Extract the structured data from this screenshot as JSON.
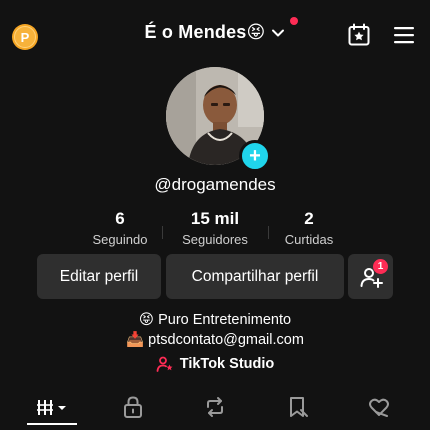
{
  "header": {
    "coin_label": "P",
    "title": "É o Mendes😝",
    "has_notification": true
  },
  "profile": {
    "username": "@drogamendes",
    "stats": [
      {
        "value": "6",
        "label": "Seguindo"
      },
      {
        "value": "15 mil",
        "label": "Seguidores"
      },
      {
        "value": "2",
        "label": "Curtidas"
      }
    ],
    "buttons": {
      "edit": "Editar perfil",
      "share": "Compartilhar perfil",
      "add_friends_badge": "1"
    },
    "bio": [
      {
        "emoji": "😝",
        "text": "Puro Entretenimento"
      },
      {
        "emoji": "📥",
        "text": "ptsdcontato@gmail.com"
      }
    ],
    "studio_label": "TikTok Studio"
  },
  "tabs": [
    {
      "icon": "grid-icon",
      "active": true
    },
    {
      "icon": "lock-icon",
      "active": false
    },
    {
      "icon": "repost-icon",
      "active": false
    },
    {
      "icon": "bookmark-icon",
      "active": false
    },
    {
      "icon": "liked-icon",
      "active": false
    }
  ],
  "colors": {
    "background": "#121212",
    "button": "#2f2f2f",
    "accent_red": "#fe2c55",
    "accent_cyan": "#20d5ec",
    "coin": "#f5a524"
  }
}
